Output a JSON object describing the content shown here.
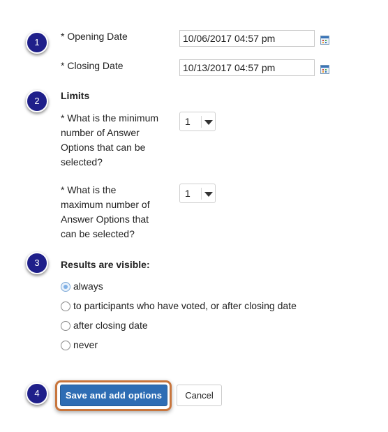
{
  "steps": [
    "1",
    "2",
    "3",
    "4"
  ],
  "dates": {
    "opening_label": "* Opening Date",
    "opening_value": "10/06/2017 04:57 pm",
    "closing_label": "* Closing Date",
    "closing_value": "10/13/2017 04:57 pm"
  },
  "limits": {
    "heading": "Limits",
    "min_question": [
      "* What is the minimum",
      "number of Answer",
      "Options that can be",
      "selected?"
    ],
    "min_value": "1",
    "max_question": [
      "* What is the",
      "maximum number of",
      "Answer Options that",
      "can be selected?"
    ],
    "max_value": "1"
  },
  "results": {
    "heading": "Results are visible:",
    "options": [
      {
        "label": "always",
        "checked": true
      },
      {
        "label": "to participants who have voted, or after closing date",
        "checked": false
      },
      {
        "label": "after closing date",
        "checked": false
      },
      {
        "label": "never",
        "checked": false
      }
    ]
  },
  "buttons": {
    "save": "Save and add options",
    "cancel": "Cancel"
  },
  "colors": {
    "badge": "#1f1f8a",
    "primary_button": "#2e6db4",
    "highlight_border": "#c8753c"
  }
}
